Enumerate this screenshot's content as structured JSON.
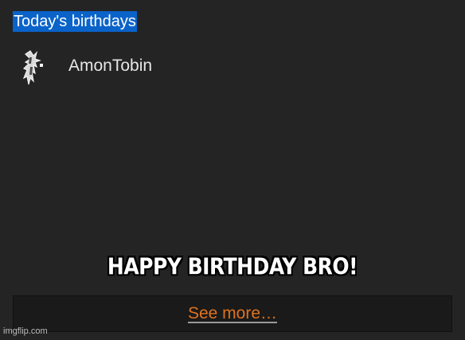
{
  "widget": {
    "title": "Today's birthdays",
    "users": [
      {
        "name": "AmonTobin",
        "avatar_icon": "user-avatar-icon"
      }
    ],
    "see_more_label": "See more…"
  },
  "meme": {
    "caption": "HAPPY BIRTHDAY BRO!"
  },
  "watermark": "imgflip.com",
  "colors": {
    "background": "#242424",
    "title_highlight": "#0a63c9",
    "link": "#e0721d",
    "bar": "#1a1a1a"
  }
}
